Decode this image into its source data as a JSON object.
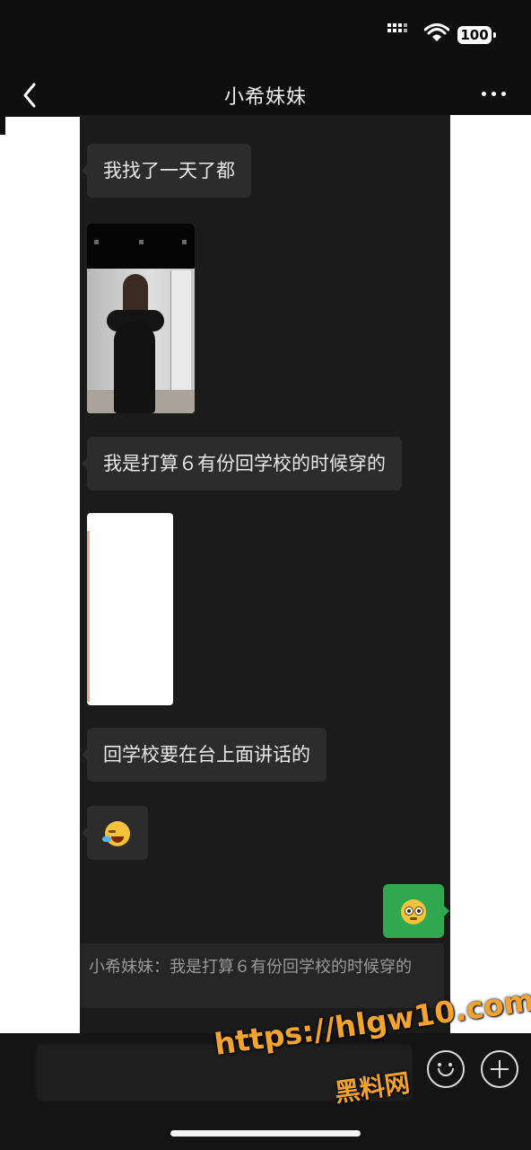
{
  "status_bar": {
    "battery": "100"
  },
  "header": {
    "title": "小希妹妹"
  },
  "messages": [
    {
      "side": "in",
      "type": "text",
      "text": "我找了一天了都"
    },
    {
      "side": "in",
      "type": "image",
      "content": "photo"
    },
    {
      "side": "in",
      "type": "text",
      "text": "我是打算６有份回学校的时候穿的"
    },
    {
      "side": "in",
      "type": "image",
      "content": "blank"
    },
    {
      "side": "in",
      "type": "text",
      "text": "回学校要在台上面讲话的"
    },
    {
      "side": "in",
      "type": "emoji",
      "icon": "sweat-laugh-emoji-icon"
    },
    {
      "side": "out",
      "type": "emoji",
      "icon": "flushed-emoji-icon"
    }
  ],
  "quote": {
    "text": "小希妹妹：我是打算６有份回学校的时候穿的"
  },
  "watermark": {
    "url": "https://hlgw10.com",
    "name": "黑料网"
  },
  "icons": [
    "back-icon",
    "more-icon",
    "signal-icon",
    "wifi-icon",
    "battery-icon",
    "emoji-button-icon",
    "plus-icon"
  ],
  "colors": {
    "outgoing_bubble": "#2fa84f",
    "incoming_bubble": "#2c2c2c",
    "watermark": "#f4a330"
  }
}
